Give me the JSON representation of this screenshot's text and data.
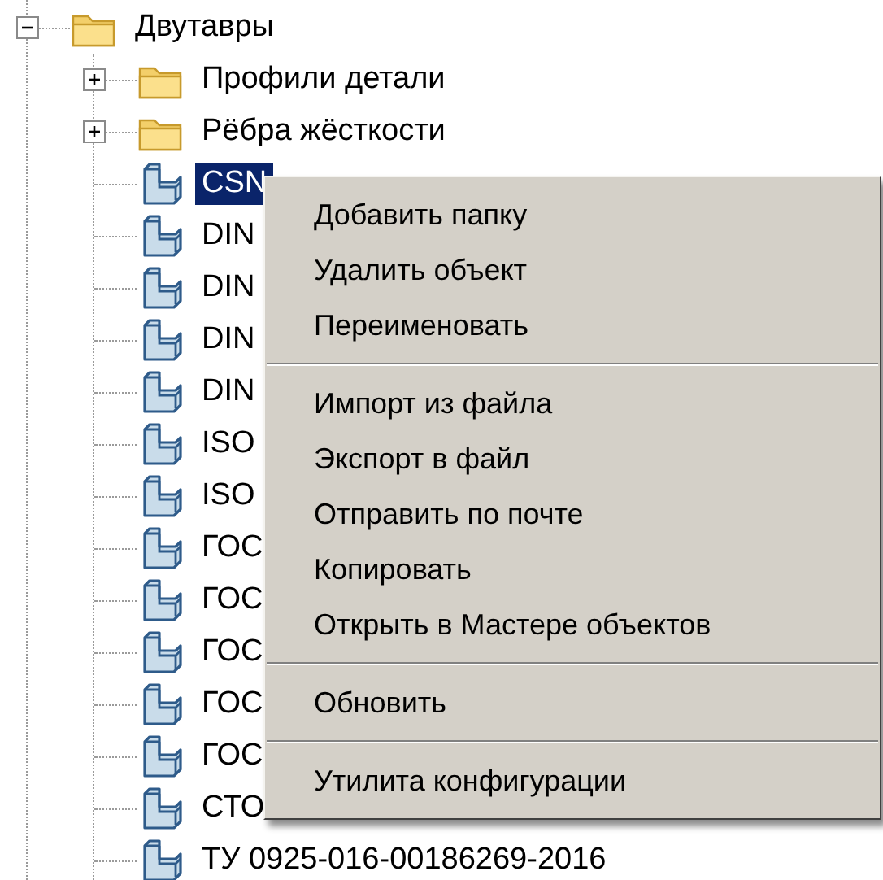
{
  "tree": {
    "label": "Двутавры",
    "kind": "folder",
    "expanded": true,
    "selected": false,
    "children": [
      {
        "label": "Профили детали",
        "kind": "folder",
        "expanded": false,
        "selected": false
      },
      {
        "label": "Рёбра жёсткости",
        "kind": "folder",
        "expanded": false,
        "selected": false
      },
      {
        "label": "CSN",
        "kind": "part",
        "selected": true
      },
      {
        "label": "DIN",
        "kind": "part",
        "selected": false
      },
      {
        "label": "DIN",
        "kind": "part",
        "selected": false
      },
      {
        "label": "DIN",
        "kind": "part",
        "selected": false
      },
      {
        "label": "DIN",
        "kind": "part",
        "selected": false
      },
      {
        "label": "ISO",
        "kind": "part",
        "selected": false
      },
      {
        "label": "ISO",
        "kind": "part",
        "selected": false
      },
      {
        "label": "ГОС",
        "kind": "part",
        "selected": false
      },
      {
        "label": "ГОС",
        "kind": "part",
        "selected": false
      },
      {
        "label": "ГОС",
        "kind": "part",
        "selected": false
      },
      {
        "label": "ГОС",
        "kind": "part",
        "selected": false
      },
      {
        "label": "ГОС",
        "kind": "part",
        "selected": false
      },
      {
        "label": "СТО",
        "kind": "part",
        "selected": false
      },
      {
        "label": "ТУ 0925-016-00186269-2016",
        "kind": "part",
        "selected": false
      }
    ]
  },
  "context_menu": {
    "groups": [
      [
        "Добавить папку",
        "Удалить объект",
        "Переименовать"
      ],
      [
        "Импорт из файла",
        "Экспорт в файл",
        "Отправить по почте",
        "Копировать",
        "Открыть в Мастере объектов"
      ],
      [
        "Обновить"
      ],
      [
        "Утилита конфигурации"
      ]
    ]
  }
}
